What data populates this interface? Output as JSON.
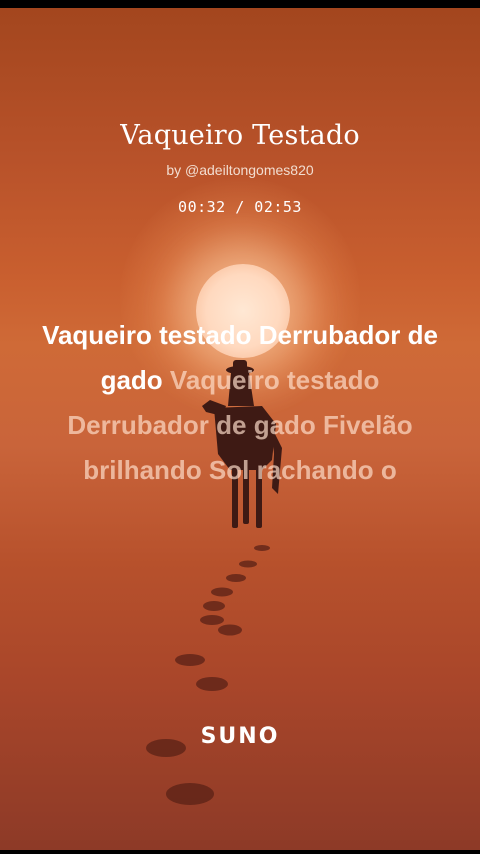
{
  "song": {
    "title": "Vaqueiro Testado",
    "byline": "by @adeiltongomes820"
  },
  "player": {
    "current_time": "00:32",
    "separator": " / ",
    "total_time": "02:53"
  },
  "lyrics": {
    "sung": "Vaqueiro testado Derrubador de gado",
    "upcoming": "Vaqueiro testado Derrubador de gado Fivelão brilhando Sol rachando o"
  },
  "brand": {
    "logo_text": "SUNO"
  },
  "colors": {
    "background_top": "#a3461e",
    "background_mid": "#cf6a37",
    "background_bottom": "#8d3a27",
    "sun": "#ffe3cc",
    "text_primary": "#ffffff"
  }
}
